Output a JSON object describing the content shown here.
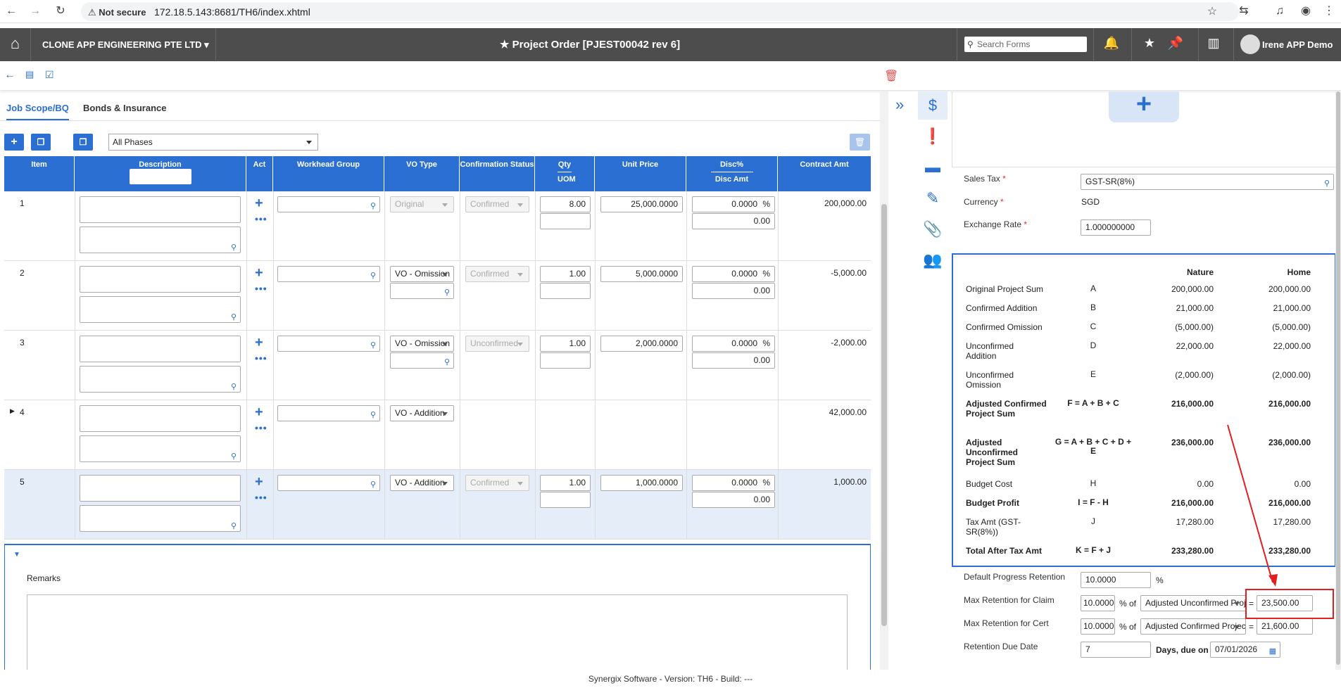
{
  "browser": {
    "security": "Not secure",
    "url": "172.18.5.143:8681/TH6/index.xhtml"
  },
  "header": {
    "company": "CLONE APP ENGINEERING PTE LTD",
    "title": "Project Order [PJEST00042 rev 6]",
    "search_placeholder": "Search Forms",
    "user": "Irene APP Demo"
  },
  "tabs": [
    {
      "label": "Job Scope/BQ"
    },
    {
      "label": "Bonds & Insurance"
    }
  ],
  "phase_select": "All Phases",
  "columns": {
    "item": "Item",
    "description": "Description",
    "act": "Act",
    "workhead": "Workhead Group",
    "vo_type": "VO Type",
    "confirmation": "Confirmation Status",
    "qty": "Qty",
    "uom": "UOM",
    "unit_price": "Unit Price",
    "disc_pct": "Disc%",
    "disc_amt": "Disc Amt",
    "contract_amt": "Contract Amt"
  },
  "rows": [
    {
      "item": "1",
      "vo_type": "Original",
      "status": "Confirmed",
      "qty": "8.00",
      "unit_price": "25,000.0000",
      "disc_pct": "0.0000",
      "pct_sign": "%",
      "disc_amt": "0.00",
      "contract_amt": "200,000.00"
    },
    {
      "item": "2",
      "vo_type": "VO - Omission",
      "status": "Confirmed",
      "qty": "1.00",
      "unit_price": "5,000.0000",
      "disc_pct": "0.0000",
      "pct_sign": "%",
      "disc_amt": "0.00",
      "contract_amt": "-5,000.00"
    },
    {
      "item": "3",
      "vo_type": "VO - Omission",
      "status": "Unconfirmed",
      "qty": "1.00",
      "unit_price": "2,000.0000",
      "disc_pct": "0.0000",
      "pct_sign": "%",
      "disc_amt": "0.00",
      "contract_amt": "-2,000.00"
    },
    {
      "item": "4",
      "vo_type": "VO - Addition",
      "contract_amt": "42,000.00"
    },
    {
      "item": "5",
      "vo_type": "VO - Addition",
      "status": "Confirmed",
      "qty": "1.00",
      "unit_price": "1,000.0000",
      "disc_pct": "0.0000",
      "pct_sign": "%",
      "disc_amt": "0.00",
      "contract_amt": "1,000.00"
    }
  ],
  "remarks_label": "Remarks",
  "right": {
    "sales_tax_label": "Sales Tax",
    "sales_tax_value": "GST-SR(8%)",
    "currency_label": "Currency",
    "currency_value": "SGD",
    "exchange_label": "Exchange Rate",
    "exchange_value": "1.000000000",
    "required_mark": "*",
    "summary_headers": {
      "nature": "Nature",
      "home": "Home"
    },
    "summary": [
      {
        "label": "Original Project Sum",
        "formula": "A",
        "nature": "200,000.00",
        "home": "200,000.00"
      },
      {
        "label": "Confirmed Addition",
        "formula": "B",
        "nature": "21,000.00",
        "home": "21,000.00"
      },
      {
        "label": "Confirmed Omission",
        "formula": "C",
        "nature": "(5,000.00)",
        "home": "(5,000.00)"
      },
      {
        "label": "Unconfirmed Addition",
        "formula": "D",
        "nature": "22,000.00",
        "home": "22,000.00"
      },
      {
        "label": "Unconfirmed Omission",
        "formula": "E",
        "nature": "(2,000.00)",
        "home": "(2,000.00)"
      },
      {
        "label": "Adjusted Confirmed Project Sum",
        "formula": "F = A + B + C",
        "nature": "216,000.00",
        "home": "216,000.00"
      },
      {
        "label": "Adjusted Unconfirmed Project Sum",
        "formula": "G = A + B + C + D + E",
        "nature": "236,000.00",
        "home": "236,000.00"
      },
      {
        "label": "Budget Cost",
        "formula": "H",
        "nature": "0.00",
        "home": "0.00"
      },
      {
        "label": "Budget Profit",
        "formula": "I = F - H",
        "nature": "216,000.00",
        "home": "216,000.00"
      },
      {
        "label": "Tax Amt (GST-SR(8%))",
        "formula": "J",
        "nature": "17,280.00",
        "home": "17,280.00"
      },
      {
        "label": "Total After Tax Amt",
        "formula": "K = F + J",
        "nature": "233,280.00",
        "home": "233,280.00"
      }
    ],
    "default_retention_label": "Default Progress Retention",
    "default_retention_value": "10.0000",
    "pct": "%",
    "max_claim_label": "Max Retention for Claim",
    "max_claim_pct": "10.0000",
    "pct_of": "% of",
    "max_claim_basis": "Adjusted Unconfirmed Project Sum",
    "equals": "=",
    "max_claim_value": "23,500.00",
    "max_cert_label": "Max Retention for Cert",
    "max_cert_pct": "10.0000",
    "max_cert_basis": "Adjusted Confirmed Project Sum",
    "max_cert_value": "21,600.00",
    "due_label": "Retention Due Date",
    "due_days": "7",
    "due_on": "Days, due on",
    "due_date": "07/01/2026"
  },
  "footer": "Synergix Software - Version: TH6 - Build: ---",
  "colors": {
    "accent": "#2a6fd1",
    "header_bg": "#4d4d4d",
    "highlight": "#e02020"
  }
}
